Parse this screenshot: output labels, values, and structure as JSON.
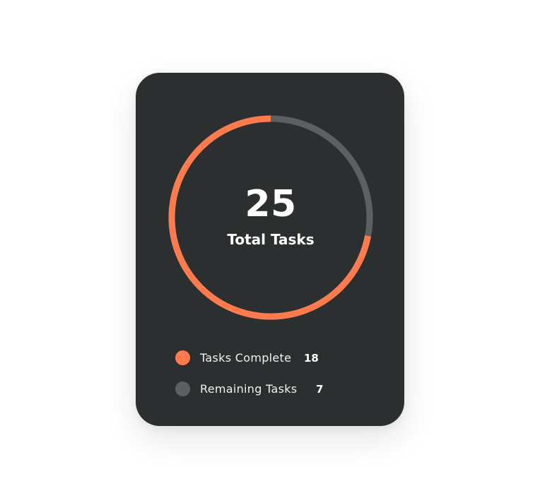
{
  "summary": {
    "total_value": "25",
    "total_label": "Total Tasks"
  },
  "progress": {
    "completed": 18,
    "remaining": 7,
    "total": 25
  },
  "legend": {
    "items": [
      {
        "label": "Tasks Complete",
        "value": "18",
        "color": "#ff7a4d"
      },
      {
        "label": "Remaining Tasks",
        "value": "7",
        "color": "#5b6062"
      }
    ]
  },
  "colors": {
    "card_background": "#2b2f30",
    "accent": "#ff7a4d",
    "track": "#5b6062",
    "text": "#ffffff"
  }
}
